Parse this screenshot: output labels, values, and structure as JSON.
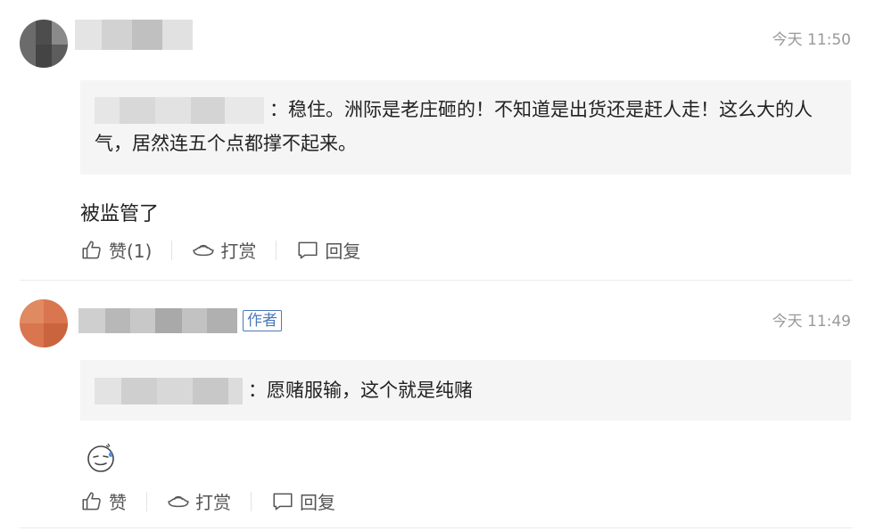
{
  "comments": [
    {
      "time": "今天 11:50",
      "quote_text": "：稳住。洲际是老庄砸的！不知道是出货还是赶人走！这么大的人气，居然连五个点都撑不起来。",
      "reply": "被监管了",
      "actions": {
        "like": "赞(1)",
        "tip": "打赏",
        "reply": "回复"
      }
    },
    {
      "author_badge": "作者",
      "time": "今天 11:49",
      "quote_text": "：愿赌服输，这个就是纯赌",
      "reply_emoji": "sweat-smile-emoji-icon",
      "actions": {
        "like": "赞",
        "tip": "打赏",
        "reply": "回复"
      }
    }
  ],
  "colors": {
    "badge": "#4a79b8",
    "quote_bg": "#f5f5f5",
    "time": "#999999"
  }
}
